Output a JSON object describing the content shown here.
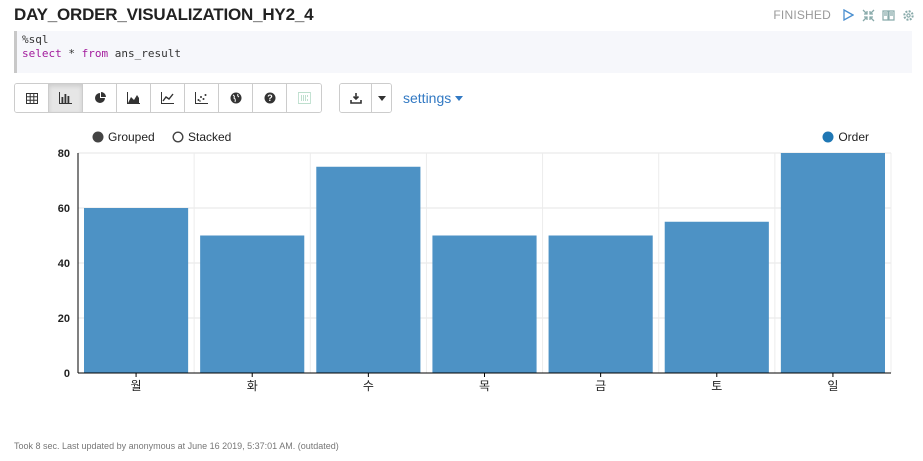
{
  "paragraph": {
    "title": "DAY_ORDER_VISUALIZATION_HY2_4",
    "status": "FINISHED"
  },
  "editor": {
    "line1": "%sql",
    "line2_kw1": "select",
    "line2_mid": " * ",
    "line2_kw2": "from",
    "line2_rest": " ans_result"
  },
  "toolbar": {
    "buttons": [
      "table-icon",
      "bar-chart-icon",
      "pie-chart-icon",
      "area-chart-icon",
      "line-chart-icon",
      "scatter-chart-icon",
      "globe-icon",
      "help-icon",
      "network-icon"
    ],
    "active": "bar-chart-icon"
  },
  "settings_label": "settings",
  "chart_modes": {
    "grouped": "Grouped",
    "stacked": "Stacked",
    "selected": "grouped"
  },
  "colors": {
    "bar": "#4d92c5",
    "legend": "#1f77b4",
    "accent": "#3279c3"
  },
  "chart_data": {
    "type": "bar",
    "categories": [
      "월",
      "화",
      "수",
      "목",
      "금",
      "토",
      "일"
    ],
    "series": [
      {
        "name": "Order",
        "values": [
          60,
          50,
          75,
          50,
          50,
          55,
          80
        ]
      }
    ],
    "yticks": [
      0,
      20,
      40,
      60,
      80
    ],
    "ylim": [
      0,
      80
    ],
    "grid": true,
    "legend_position": "top-right"
  },
  "footer": "Took 8 sec. Last updated by anonymous at June 16 2019, 5:37:01 AM. (outdated)"
}
